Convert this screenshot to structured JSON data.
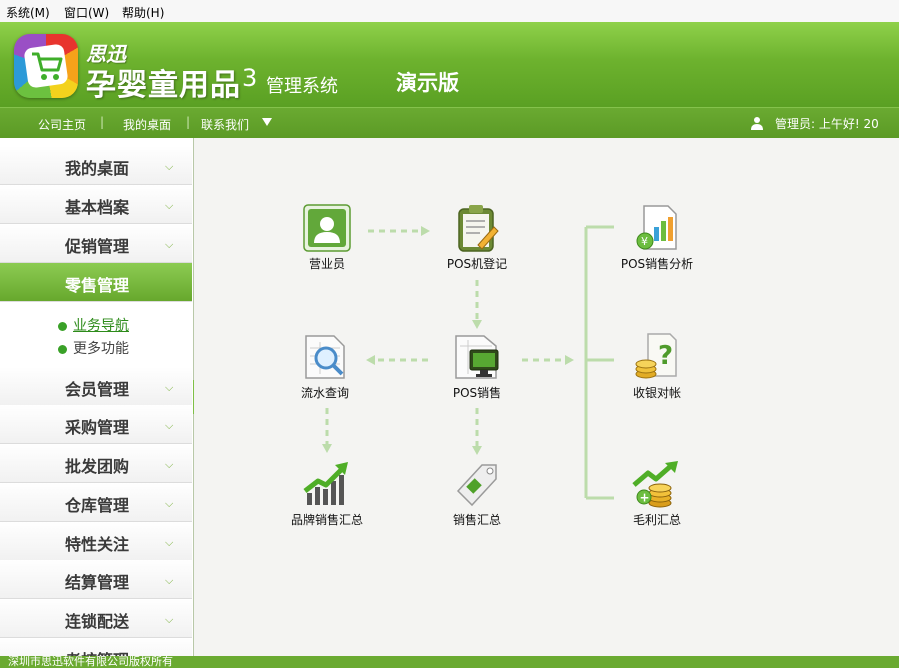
{
  "menubar": {
    "items": [
      "系统(M)",
      "窗口(W)",
      "帮助(H)"
    ]
  },
  "header": {
    "brand_top": "思迅",
    "brand_main": "孕婴童用品",
    "version": "3",
    "system": "管理系统",
    "edition": "演示版"
  },
  "navbar": {
    "links": [
      "公司主页",
      "我的桌面",
      "联系我们"
    ],
    "user_text": "管理员:  上午好!   20"
  },
  "sidebar": {
    "items": [
      "我的桌面",
      "基本档案",
      "促销管理",
      "零售管理",
      "会员管理",
      "采购管理",
      "批发团购",
      "仓库管理",
      "特性关注",
      "结算管理",
      "连锁配送",
      "考核管理"
    ],
    "active": "零售管理",
    "sub_items": [
      "业务导航",
      "更多功能"
    ]
  },
  "flow": {
    "nodes": {
      "cashier": "营业员",
      "pos_register": "POS机登记",
      "pos_analysis": "POS销售分析",
      "flow_query": "流水查询",
      "pos_sales": "POS销售",
      "cash_reconcile": "收银对帐",
      "brand_sales": "品牌销售汇总",
      "sales_summary": "销售汇总",
      "profit_summary": "毛利汇总"
    }
  },
  "footer": {
    "text": "深圳市思迅软件有限公司版权所有"
  },
  "colors": {
    "brand_green": "#6aaa31",
    "accent_green": "#2d8b1a",
    "panel_bg": "#f4f4f2"
  }
}
